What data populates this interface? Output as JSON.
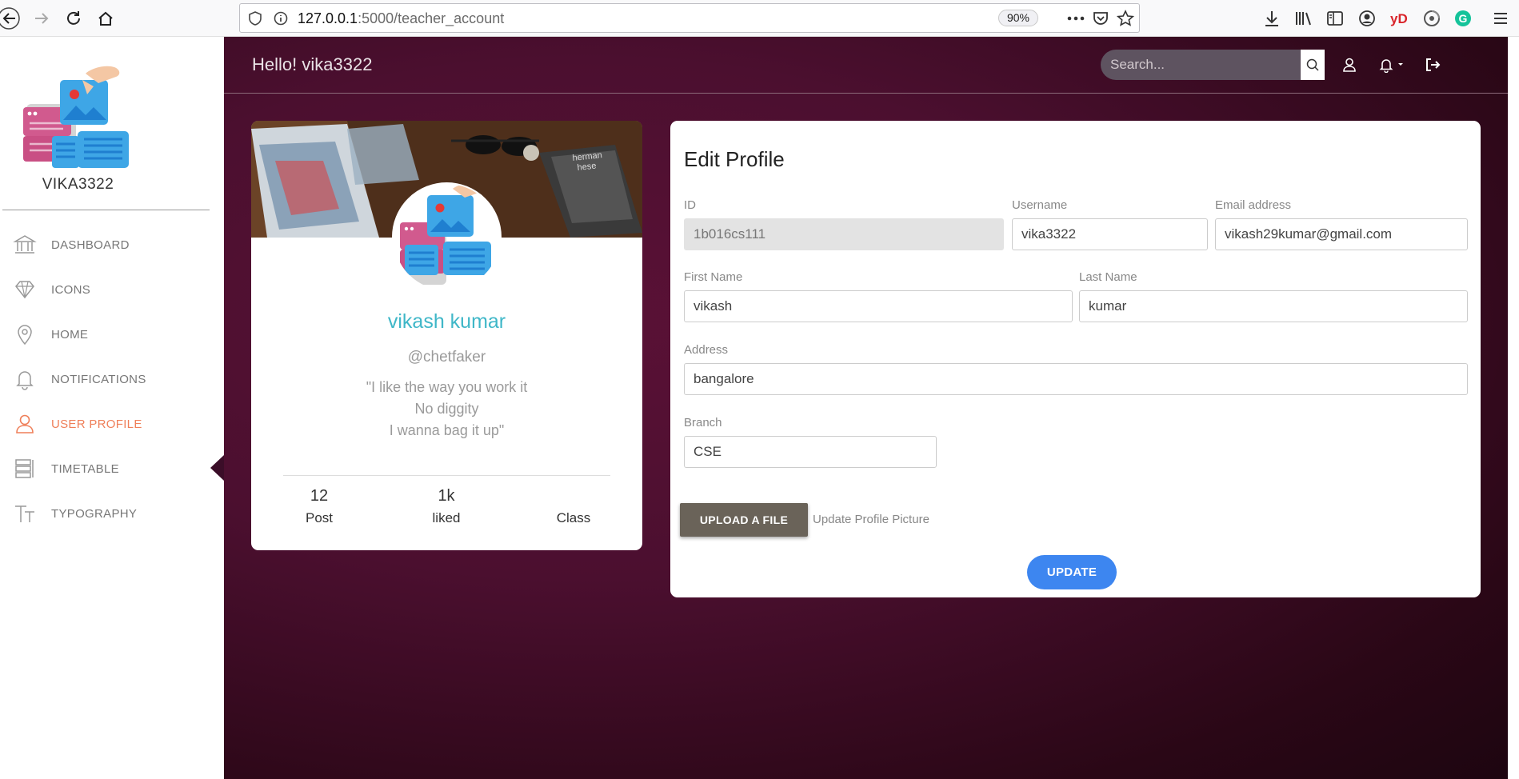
{
  "browser": {
    "url_host": "127.0.0.1",
    "url_path": ":5000/teacher_account",
    "zoom": "90%"
  },
  "sidebar": {
    "brand": "VIKA3322",
    "items": [
      {
        "label": "DASHBOARD",
        "icon": "bank-icon"
      },
      {
        "label": "ICONS",
        "icon": "diamond-icon"
      },
      {
        "label": "HOME",
        "icon": "map-pin-icon"
      },
      {
        "label": "NOTIFICATIONS",
        "icon": "bell-icon"
      },
      {
        "label": "USER PROFILE",
        "icon": "user-icon",
        "active": true
      },
      {
        "label": "TIMETABLE",
        "icon": "timetable-icon"
      },
      {
        "label": "TYPOGRAPHY",
        "icon": "typography-icon"
      }
    ],
    "active_color": "#ef7f59"
  },
  "topbar": {
    "greeting": "Hello! vika3322",
    "search_placeholder": "Search..."
  },
  "profile": {
    "name": "vikash kumar",
    "handle": "@chetfaker",
    "quote": [
      "\"I like the way you work it",
      "No diggity",
      "I wanna bag it up\""
    ],
    "stats": [
      {
        "value": "12",
        "label": "Post"
      },
      {
        "value": "1k",
        "label": "liked"
      },
      {
        "value": "",
        "label": "Class"
      }
    ]
  },
  "edit_profile": {
    "title": "Edit Profile",
    "id_label": "ID",
    "id_value": "1b016cs111",
    "username_label": "Username",
    "username_value": "vika3322",
    "email_label": "Email address",
    "email_value": "vikash29kumar@gmail.com",
    "first_name_label": "First Name",
    "first_name_value": "vikash",
    "last_name_label": "Last Name",
    "last_name_value": "kumar",
    "address_label": "Address",
    "address_value": "bangalore",
    "branch_label": "Branch",
    "branch_value": "CSE",
    "upload_label": "UPLOAD A FILE",
    "upload_hint": "Update Profile Picture",
    "update_label": "UPDATE"
  },
  "colors": {
    "accent_teal": "#3fb7c8",
    "update_blue": "#3d86f0",
    "background_maroon": "#4b0f2f"
  }
}
